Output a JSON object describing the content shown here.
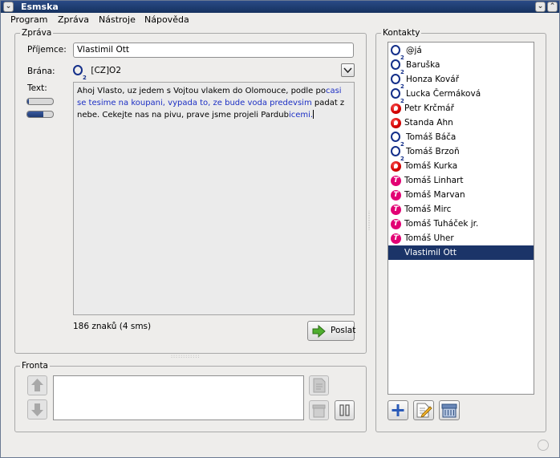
{
  "window": {
    "title": "Esmska"
  },
  "menu": [
    "Program",
    "Zpráva",
    "Nástroje",
    "Nápověda"
  ],
  "message": {
    "group_label": "Zpráva",
    "recipient_label": "Příjemce:",
    "recipient_value": "Vlastimil Ott",
    "gateway_label": "Brána:",
    "gateway_value": "[CZ]O2",
    "text_label": "Text:",
    "text_normal_1": "Ahoj Vlasto, uz jedem s Vojtou vlakem do Olomouce, podle po",
    "text_hl_1": "casi se tesime na koupani, vypada to, ze bude voda predevsim",
    "text_normal_2": " padat z nebe. Cekejte nas na pivu, prave jsme projeli Pardub",
    "text_hl_2": "icemi.",
    "progress_1": 0.05,
    "progress_2": 0.62,
    "char_count": "186 znaků (4 sms)",
    "send_label": "Poslat"
  },
  "queue": {
    "group_label": "Fronta"
  },
  "contacts": {
    "group_label": "Kontakty",
    "items": [
      {
        "name": "@já",
        "op": "o2"
      },
      {
        "name": "Baruška",
        "op": "o2"
      },
      {
        "name": "Honza Kovář",
        "op": "o2"
      },
      {
        "name": "Lucka Čermáková",
        "op": "o2"
      },
      {
        "name": "Petr Krčmář",
        "op": "vodafone"
      },
      {
        "name": "Standa Ahn",
        "op": "vodafone"
      },
      {
        "name": "Tomáš Báča",
        "op": "o2"
      },
      {
        "name": "Tomáš Brzoň",
        "op": "o2"
      },
      {
        "name": "Tomáš Kurka",
        "op": "vodafone"
      },
      {
        "name": "Tomáš Linhart",
        "op": "tmobile"
      },
      {
        "name": "Tomáš Marvan",
        "op": "tmobile"
      },
      {
        "name": "Tomáš Mirc",
        "op": "tmobile"
      },
      {
        "name": "Tomáš Tuháček jr.",
        "op": "tmobile"
      },
      {
        "name": "Tomáš Uher",
        "op": "tmobile"
      },
      {
        "name": "Vlastimil Ott",
        "op": "tmobile",
        "selected": true
      }
    ]
  },
  "colors": {
    "titlebar": "#1f3f78",
    "selection": "#1b3468",
    "highlight_text": "#1c2fc4"
  }
}
